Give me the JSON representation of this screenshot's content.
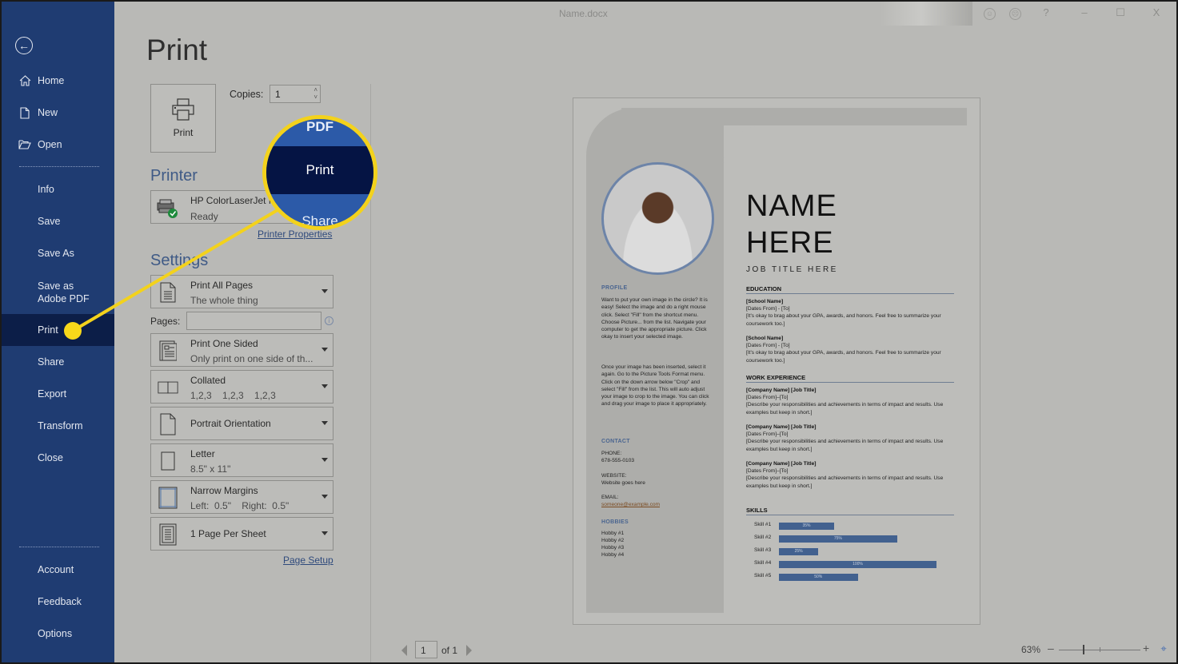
{
  "window": {
    "title": "Name.docx",
    "controls": {
      "smile": "☺",
      "frown": "☹",
      "help": "?",
      "minimize": "–",
      "maximize": "☐",
      "close": "X"
    }
  },
  "sidebar": {
    "back_icon": "←",
    "items": [
      {
        "label": "Home",
        "icon": "home-icon"
      },
      {
        "label": "New",
        "icon": "new-document-icon"
      },
      {
        "label": "Open",
        "icon": "open-folder-icon"
      },
      {
        "label": "Info"
      },
      {
        "label": "Save"
      },
      {
        "label": "Save As"
      },
      {
        "label": "Save as Adobe PDF"
      },
      {
        "label": "Print",
        "active": true
      },
      {
        "label": "Share"
      },
      {
        "label": "Export"
      },
      {
        "label": "Transform"
      },
      {
        "label": "Close"
      },
      {
        "label": "Account"
      },
      {
        "label": "Feedback"
      },
      {
        "label": "Options"
      }
    ]
  },
  "print": {
    "title": "Print",
    "print_button": "Print",
    "copies_label": "Copies:",
    "copies_value": "1",
    "printer_heading": "Printer",
    "printer_name": "HP ColorLaserJet M",
    "printer_status": "Ready",
    "printer_properties": "Printer Properties",
    "settings_heading": "Settings",
    "pages_label": "Pages:",
    "pages_value": "",
    "info_icon": "i",
    "settings": [
      {
        "line1": "Print All Pages",
        "line2": "The whole thing",
        "icon": "document-icon"
      },
      {
        "line1": "Print One Sided",
        "line2": "Only print on one side of th...",
        "icon": "one-sided-icon"
      },
      {
        "line1": "Collated",
        "line2": "1,2,3    1,2,3    1,2,3",
        "icon": "collated-icon"
      },
      {
        "line1": "Portrait Orientation",
        "line2": "",
        "icon": "portrait-icon"
      },
      {
        "line1": "Letter",
        "line2": "8.5\" x 11\"",
        "icon": "paper-size-icon"
      },
      {
        "line1": "Narrow Margins",
        "line2": "Left:  0.5\"    Right:  0.5\"",
        "icon": "margins-icon"
      },
      {
        "line1": "1 Page Per Sheet",
        "line2": "",
        "icon": "pages-per-sheet-icon"
      }
    ],
    "page_setup": "Page Setup"
  },
  "callout": {
    "top": "PDF",
    "middle": "Print",
    "bottom": "Share",
    "color": "#f3d21c"
  },
  "preview": {
    "name_line1": "NAME",
    "name_line2": "HERE",
    "job_title": "JOB TITLE HERE",
    "profile_heading": "PROFILE",
    "profile_p1": "Want to put your own image in the circle? It is easy! Select the image and do a right mouse click. Select \"Fill\" from the shortcut menu. Choose Picture... from the list. Navigate your computer to get the appropriate picture. Click okay to insert your selected image.",
    "profile_p2": "Once your image has been inserted, select it again. Go to the Picture Tools Format menu. Click on the down arrow below \"Crop\" and select \"Fill\" from the list. This will auto adjust your image to crop to the image. You can click and drag your image to place it appropriately.",
    "contact_heading": "CONTACT",
    "phone_label": "PHONE:",
    "phone": "678-555-0103",
    "website_label": "WEBSITE:",
    "website": "Website goes here",
    "email_label": "EMAIL:",
    "email": "someone@example.com",
    "hobbies_heading": "HOBBIES",
    "hobbies": [
      "Hobby #1",
      "Hobby #2",
      "Hobby #3",
      "Hobby #4"
    ],
    "education_heading": "EDUCATION",
    "education": [
      {
        "school": "[School Name]",
        "dates": "[Dates From] - [To]",
        "desc": "[It's okay to brag about your GPA, awards, and honors. Feel free to summarize your coursework too.]"
      },
      {
        "school": "[School Name]",
        "dates": "[Dates From] - [To]",
        "desc": "[It's okay to brag about your GPA, awards, and honors. Feel free to summarize your coursework too.]"
      }
    ],
    "work_heading": "WORK EXPERIENCE",
    "work": [
      {
        "title": "[Company Name]  [Job Title]",
        "dates": "[Dates From]–[To]",
        "desc": "[Describe your responsibilities and achievements in terms of impact and results. Use examples but keep in short.]"
      },
      {
        "title": "[Company Name]  [Job Title]",
        "dates": "[Dates From]–[To]",
        "desc": "[Describe your responsibilities and achievements in terms of impact and results. Use examples but keep in short.]"
      },
      {
        "title": "[Company Name]  [Job Title]",
        "dates": "[Dates From]–[To]",
        "desc": "[Describe your responsibilities and achievements in terms of impact and results. Use examples but keep in short.]"
      }
    ],
    "skills_heading": "SKILLS",
    "skills": [
      {
        "label": "Skill #1",
        "percent": 35,
        "text": "35%"
      },
      {
        "label": "Skill #2",
        "percent": 75,
        "text": "75%"
      },
      {
        "label": "Skill #3",
        "percent": 25,
        "text": "25%"
      },
      {
        "label": "Skill #4",
        "percent": 100,
        "text": "100%"
      },
      {
        "label": "Skill #5",
        "percent": 50,
        "text": "50%"
      }
    ]
  },
  "footer": {
    "page_value": "1",
    "page_of": "of 1",
    "zoom_text": "63%",
    "zoom_percent": 63,
    "zoom_minus": "–",
    "zoom_plus": "+",
    "fit_icon": "⌖"
  }
}
